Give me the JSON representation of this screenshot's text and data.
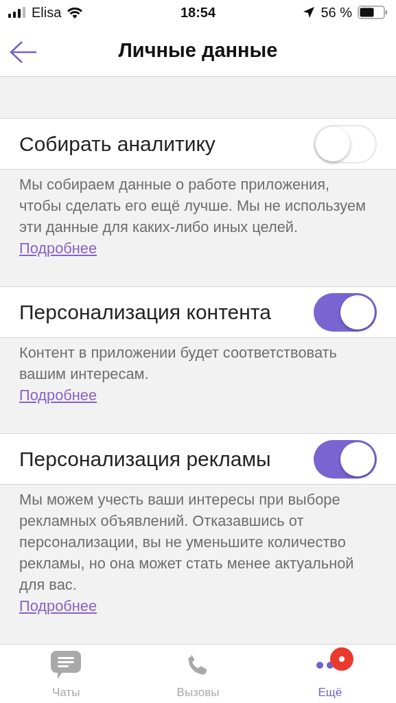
{
  "status_bar": {
    "carrier": "Elisa",
    "time": "18:54",
    "battery": "56 %"
  },
  "nav": {
    "title": "Личные данные"
  },
  "settings": [
    {
      "label": "Собирать аналитику",
      "on": false,
      "description": "Мы собираем данные о работе приложения, чтобы сделать его ещё лучше. Мы не используем эти данные для каких-либо иных целей.",
      "link": "Подробнее",
      "kind": "inline-link"
    },
    {
      "label": "Персонализация контента",
      "on": true,
      "description": "Контент в приложении будет соответствовать вашим интересам.",
      "link": "Подробнее",
      "kind": "block-link"
    },
    {
      "label": "Персонализация рекламы",
      "on": true,
      "description": "Мы можем учесть ваши интересы при выборе рекламных объявлений. Отказавшись от персонализации, вы не уменьшите количество рекламы, но она может стать менее актуальной для вас.",
      "link": "Подробнее",
      "kind": "block-link"
    }
  ],
  "tabs": [
    {
      "label": "Чаты",
      "kind": "chats",
      "selected": false
    },
    {
      "label": "Вызовы",
      "kind": "calls",
      "selected": false
    },
    {
      "label": "Ещё",
      "kind": "more",
      "selected": true,
      "badge": true
    }
  ]
}
